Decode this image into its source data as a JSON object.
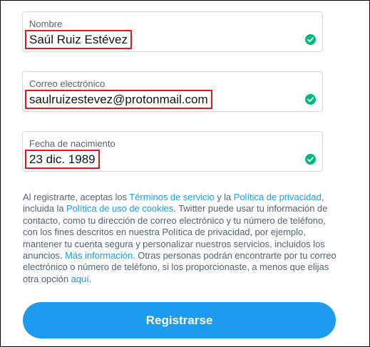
{
  "fields": {
    "name": {
      "label": "Nombre",
      "value": "Saúl Ruiz Estévez"
    },
    "email": {
      "label": "Correo electrónico",
      "value": "saulruizestevez@protonmail.com"
    },
    "birthdate": {
      "label": "Fecha de nacimiento",
      "value": "23 dic. 1989"
    }
  },
  "terms": {
    "t1": "Al registrarte, aceptas los ",
    "link_terms": "Términos de servicio",
    "t2": " y la ",
    "link_privacy": "Política de privacidad",
    "t3": ", incluida la ",
    "link_cookies": "Política de uso de cookies",
    "t4": ". Twitter puede usar tu información de contacto, como tu dirección de correo electrónico y tu número de teléfono, con los fines descritos en nuestra Política de privacidad, por ejemplo, mantener tu cuenta segura y personalizar nuestros servicios, incluidos los anuncios. ",
    "link_more": "Más información",
    "t5": ". Otras personas podrán encontrarte por tu correo electrónico o número de teléfono, si los proporcionaste, a menos que elijas otra opción ",
    "link_here": "aquí",
    "t6": "."
  },
  "register_button": {
    "label": "Registrarse"
  },
  "colors": {
    "accent": "#1d9bf0",
    "valid": "#00ba7c",
    "highlight": "#e0191b"
  },
  "icons": {
    "valid": "check-circle-icon"
  }
}
